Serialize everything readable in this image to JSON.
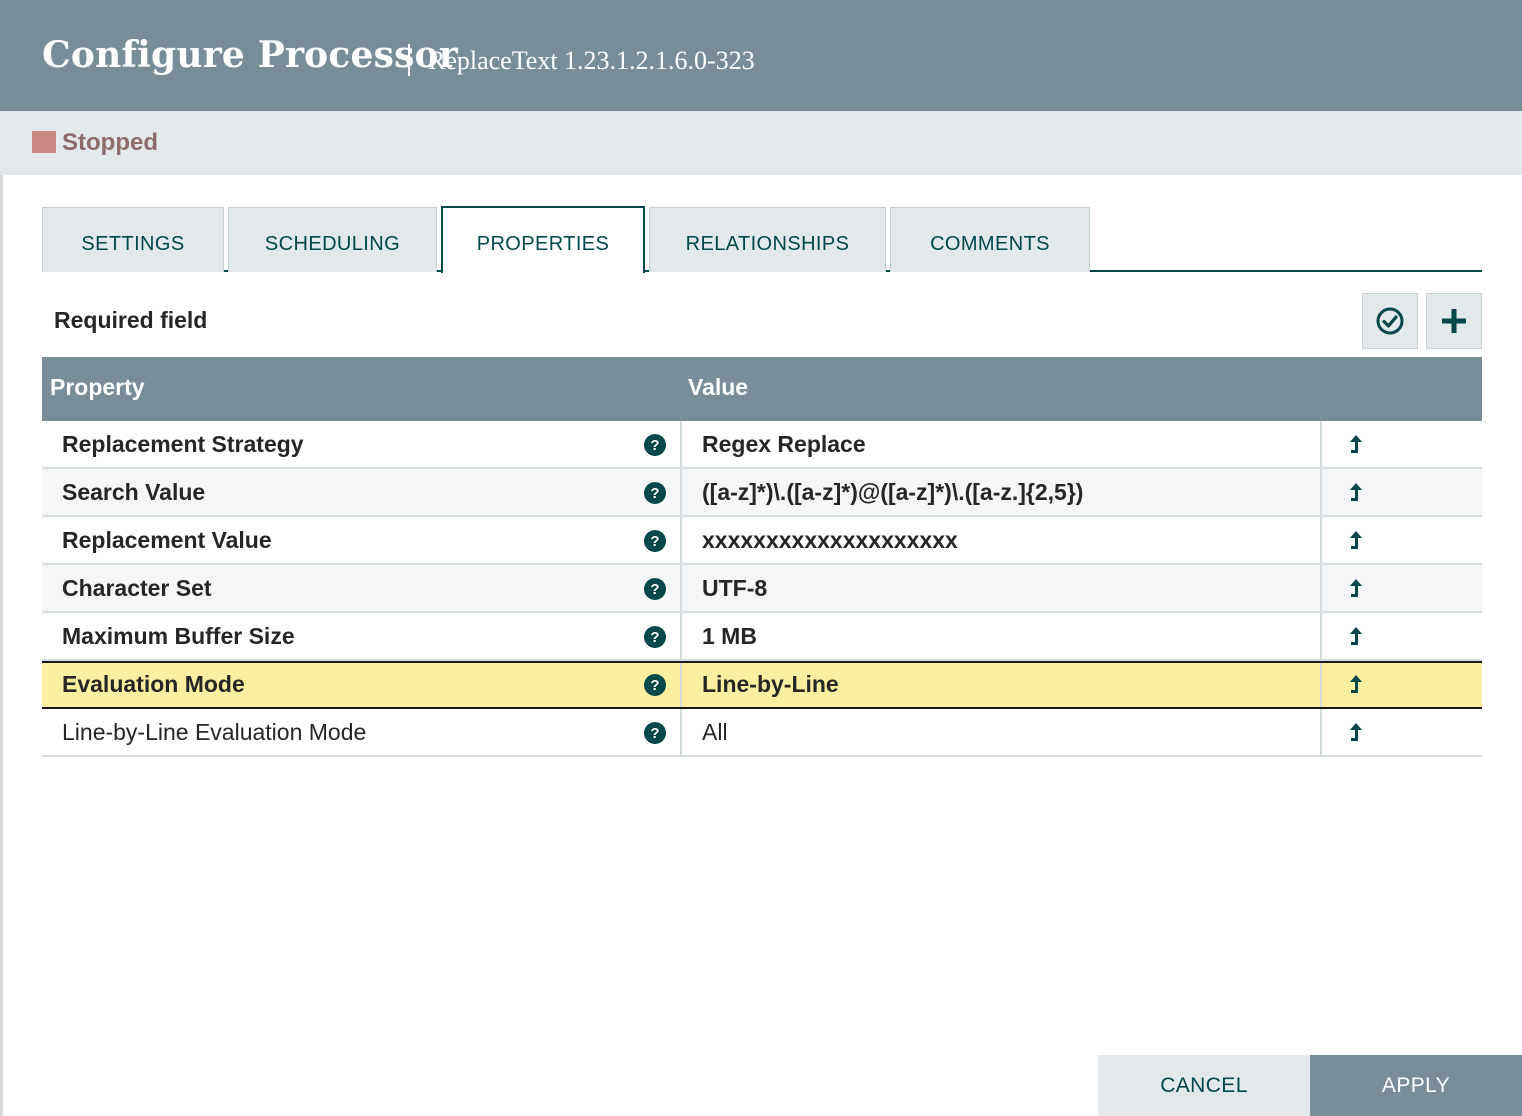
{
  "header": {
    "title": "Configure Processor",
    "subtitle": "ReplaceText 1.23.1.2.1.6.0-323"
  },
  "status": {
    "label": "Stopped",
    "color": "#c98781"
  },
  "tabs": [
    {
      "label": "SETTINGS",
      "active": false
    },
    {
      "label": "SCHEDULING",
      "active": false
    },
    {
      "label": "PROPERTIES",
      "active": true
    },
    {
      "label": "RELATIONSHIPS",
      "active": false
    },
    {
      "label": "COMMENTS",
      "active": false
    }
  ],
  "toolbar": {
    "required_label": "Required field",
    "verify_icon": "check-circle-icon",
    "add_icon": "plus-icon"
  },
  "table": {
    "headers": {
      "property": "Property",
      "value": "Value"
    },
    "rows": [
      {
        "name": "Replacement Strategy",
        "value": "Regex Replace",
        "required": true
      },
      {
        "name": "Search Value",
        "value": "([a-z]*)\\.([a-z]*)@([a-z]*)\\.([a-z.]{2,5})",
        "required": true
      },
      {
        "name": "Replacement Value",
        "value": "xxxxxxxxxxxxxxxxxxxx",
        "required": true
      },
      {
        "name": "Character Set",
        "value": "UTF-8",
        "required": true
      },
      {
        "name": "Maximum Buffer Size",
        "value": "1 MB",
        "required": true
      },
      {
        "name": "Evaluation Mode",
        "value": "Line-by-Line",
        "required": true,
        "selected": true
      },
      {
        "name": "Line-by-Line Evaluation Mode",
        "value": "All",
        "required": false
      }
    ],
    "help_glyph": "?"
  },
  "footer": {
    "cancel_label": "CANCEL",
    "apply_label": "APPLY"
  },
  "colors": {
    "header_bg": "#798d98",
    "accent": "#004849",
    "selected_row": "#fcf0a0",
    "stopped": "#c98781"
  }
}
